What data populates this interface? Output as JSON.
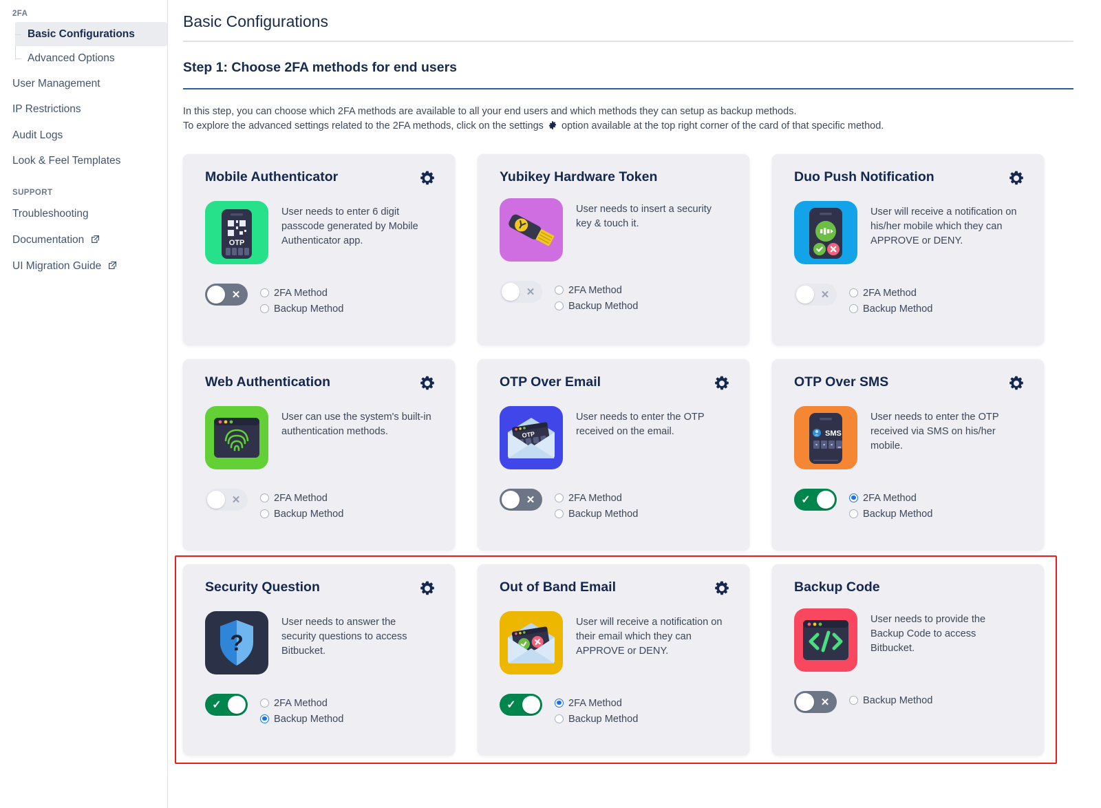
{
  "sidebar": {
    "group_label": "2FA",
    "sub_items": [
      {
        "label": "Basic Configurations",
        "active": true
      },
      {
        "label": "Advanced Options",
        "active": false
      }
    ],
    "items": [
      {
        "label": "User Management"
      },
      {
        "label": "IP Restrictions"
      },
      {
        "label": "Audit Logs"
      },
      {
        "label": "Look & Feel Templates"
      }
    ],
    "support_label": "SUPPORT",
    "support_items": [
      {
        "label": "Troubleshooting",
        "external": false
      },
      {
        "label": "Documentation",
        "external": true
      },
      {
        "label": "UI Migration Guide",
        "external": true
      }
    ]
  },
  "header": {
    "page_title": "Basic Configurations",
    "step_title": "Step 1: Choose 2FA methods for end users",
    "intro_line1": "In this step, you can choose which 2FA methods are available to all your end users and which methods they can setup as backup methods.",
    "intro_line2a": "To explore the advanced settings related to the 2FA methods, click on the settings",
    "intro_line2b": "option available at the top right corner of the card of that specific method."
  },
  "labels": {
    "method_2fa": "2FA Method",
    "method_backup": "Backup Method"
  },
  "colors": {
    "toggle_on": "#00854d",
    "toggle_off": "#6d7687",
    "toggle_disabled": "#e7e9ee",
    "radio_selected": "#1a73e8",
    "highlight_border": "#f01a1a",
    "step_rule": "#2a5fa5",
    "card_bg": "#eeeef3"
  },
  "cards": [
    {
      "title": "Mobile Authenticator",
      "desc": "User needs to enter 6 digit passcode generated by Mobile Authenticator app.",
      "has_gear": true,
      "icon": "mobile-authenticator-otp-icon",
      "icon_bg": "#27e08a",
      "toggle_state": "off",
      "radios": [
        {
          "label": "2FA Method",
          "selected": false
        },
        {
          "label": "Backup Method",
          "selected": false
        }
      ],
      "highlighted": false
    },
    {
      "title": "Yubikey Hardware Token",
      "desc": "User needs to insert a security key & touch it.",
      "has_gear": false,
      "icon": "yubikey-security-key-icon",
      "icon_bg": "#cf6ee0",
      "toggle_state": "disabled",
      "radios": [
        {
          "label": "2FA Method",
          "selected": false
        },
        {
          "label": "Backup Method",
          "selected": false
        }
      ],
      "highlighted": false
    },
    {
      "title": "Duo Push Notification",
      "desc": "User will receive a notification on his/her mobile which they can APPROVE or DENY.",
      "has_gear": true,
      "icon": "duo-push-phone-icon",
      "icon_bg": "#12a3e8",
      "toggle_state": "disabled",
      "radios": [
        {
          "label": "2FA Method",
          "selected": false
        },
        {
          "label": "Backup Method",
          "selected": false
        }
      ],
      "highlighted": false
    },
    {
      "title": "Web Authentication",
      "desc": "User can use the system's built-in authentication methods.",
      "has_gear": true,
      "icon": "webauthn-fingerprint-icon",
      "icon_bg": "#63d136",
      "toggle_state": "disabled",
      "radios": [
        {
          "label": "2FA Method",
          "selected": false
        },
        {
          "label": "Backup Method",
          "selected": false
        }
      ],
      "highlighted": false
    },
    {
      "title": "OTP Over Email",
      "desc": "User needs to enter the OTP received on the email.",
      "has_gear": true,
      "icon": "otp-email-envelope-icon",
      "icon_bg": "#4046e8",
      "toggle_state": "off",
      "radios": [
        {
          "label": "2FA Method",
          "selected": false
        },
        {
          "label": "Backup Method",
          "selected": false
        }
      ],
      "highlighted": false
    },
    {
      "title": "OTP Over SMS",
      "desc": "User needs to enter the OTP received via SMS on his/her mobile.",
      "has_gear": true,
      "icon": "otp-sms-phone-icon",
      "icon_bg": "#f58634",
      "toggle_state": "on",
      "radios": [
        {
          "label": "2FA Method",
          "selected": true
        },
        {
          "label": "Backup Method",
          "selected": false
        }
      ],
      "highlighted": false
    },
    {
      "title": "Security Question",
      "desc": "User needs to answer the security questions to access Bitbucket.",
      "has_gear": true,
      "icon": "security-question-shield-icon",
      "icon_bg": "#2b3146",
      "toggle_state": "on",
      "radios": [
        {
          "label": "2FA Method",
          "selected": false
        },
        {
          "label": "Backup Method",
          "selected": true
        }
      ],
      "highlighted": true
    },
    {
      "title": "Out of Band Email",
      "desc": "User will receive a notification on their email which they can APPROVE or DENY.",
      "has_gear": true,
      "icon": "out-of-band-email-icon",
      "icon_bg": "#edb700",
      "toggle_state": "on",
      "radios": [
        {
          "label": "2FA Method",
          "selected": true
        },
        {
          "label": "Backup Method",
          "selected": false
        }
      ],
      "highlighted": true
    },
    {
      "title": "Backup Code",
      "desc": "User needs to provide the Backup Code to access Bitbucket.",
      "has_gear": false,
      "icon": "backup-code-terminal-icon",
      "icon_bg": "#f8475f",
      "toggle_state": "off",
      "radios": [
        {
          "label": "Backup Method",
          "selected": false
        }
      ],
      "highlighted": true
    }
  ]
}
